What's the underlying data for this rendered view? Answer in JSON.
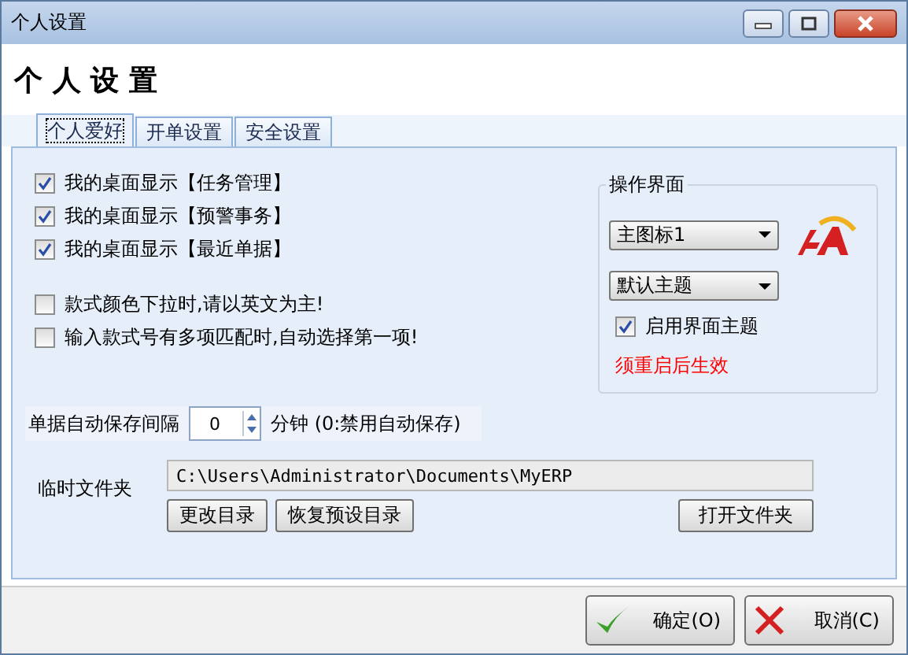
{
  "window": {
    "title": "个人设置"
  },
  "heading": "个 人 设 置",
  "tabs": [
    {
      "label": "个人爱好",
      "selected": true
    },
    {
      "label": "开单设置",
      "selected": false
    },
    {
      "label": "安全设置",
      "selected": false
    }
  ],
  "option_groups": [
    [
      {
        "label": "我的桌面显示【任务管理】",
        "checked": true
      },
      {
        "label": "我的桌面显示【预警事务】",
        "checked": true
      },
      {
        "label": "我的桌面显示【最近单据】",
        "checked": true
      }
    ],
    [
      {
        "label": "款式颜色下拉时,请以英文为主!",
        "checked": false
      },
      {
        "label": "输入款式号有多项匹配时,自动选择第一项!",
        "checked": false
      }
    ]
  ],
  "interface_group": {
    "title": "操作界面",
    "icon_select": "主图标1",
    "theme_select": "默认主题",
    "enable_theme": {
      "label": "启用界面主题",
      "checked": true
    },
    "note": "须重启后生效"
  },
  "autosave": {
    "label": "单据自动保存间隔",
    "value": "0",
    "suffix": "分钟 (0:禁用自动保存)"
  },
  "temp_folder": {
    "label": "临时文件夹",
    "path": "C:\\Users\\Administrator\\Documents\\MyERP",
    "buttons": [
      "更改目录",
      "恢复预设目录"
    ],
    "open_button": "打开文件夹"
  },
  "footer": [
    {
      "label": "确定(O)",
      "kind": "ok"
    },
    {
      "label": "取消(C)",
      "kind": "cancel"
    }
  ]
}
